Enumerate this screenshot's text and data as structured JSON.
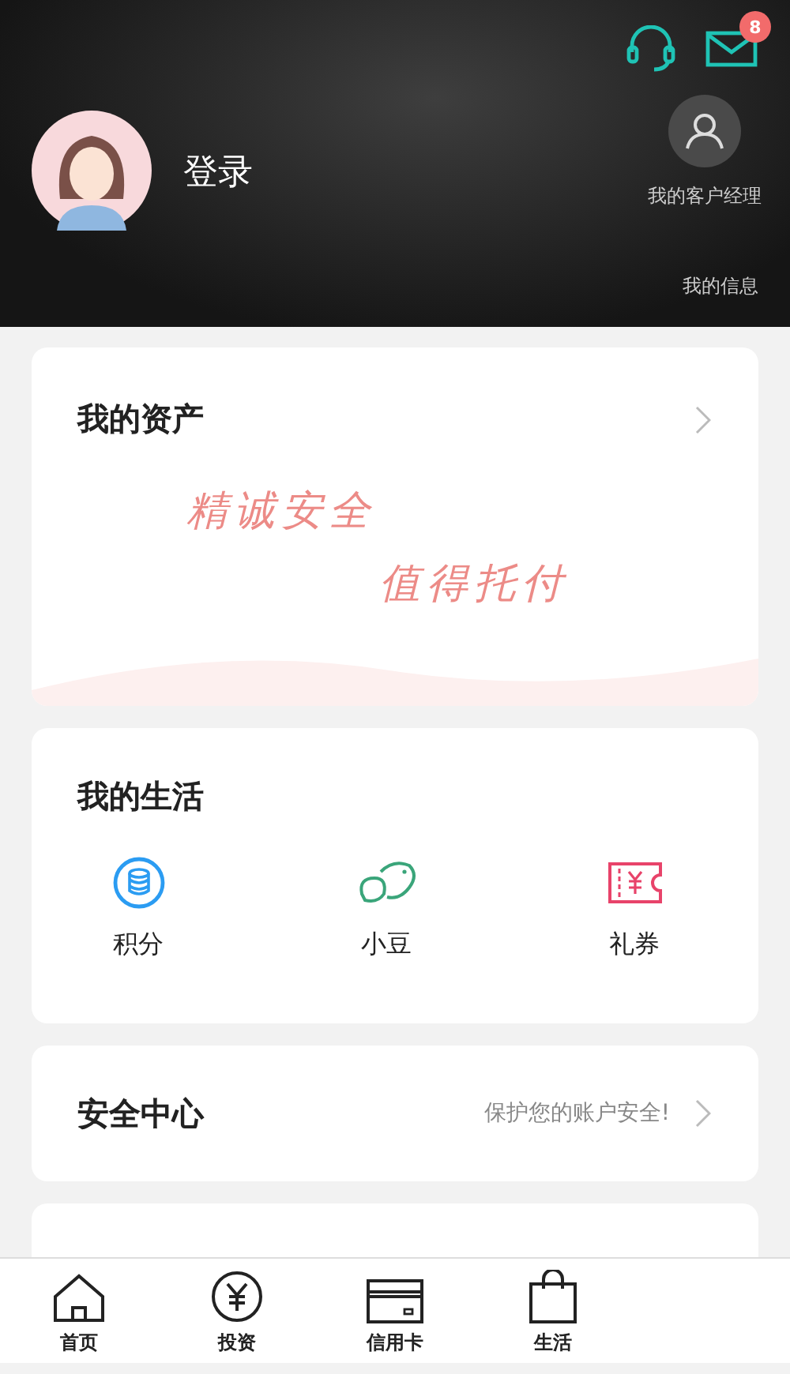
{
  "header": {
    "message_badge": "8",
    "login": "登录",
    "manager_label": "我的客户经理",
    "my_info": "我的信息"
  },
  "assets_card": {
    "title": "我的资产",
    "slogan_1": "精诚安全",
    "slogan_2": "值得托付"
  },
  "life_card": {
    "title": "我的生活",
    "items": [
      {
        "kind": "points",
        "label": "积分"
      },
      {
        "kind": "beans",
        "label": "小豆"
      },
      {
        "kind": "coupon",
        "label": "礼券"
      }
    ]
  },
  "security_card": {
    "title": "安全中心",
    "hint": "保护您的账户安全!"
  },
  "tab_bar": [
    {
      "kind": "home",
      "label": "首页"
    },
    {
      "kind": "invest",
      "label": "投资"
    },
    {
      "kind": "card",
      "label": "信用卡"
    },
    {
      "kind": "life",
      "label": "生活"
    }
  ]
}
